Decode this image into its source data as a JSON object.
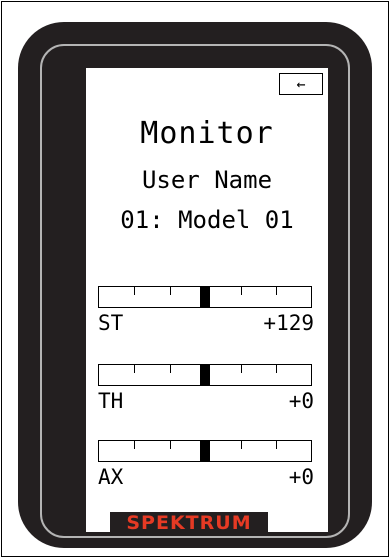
{
  "screen": {
    "back_button": "←",
    "title": "Monitor",
    "user_name": "User Name",
    "model": "01: Model 01"
  },
  "channels": [
    {
      "label": "ST",
      "value": "+129"
    },
    {
      "label": "TH",
      "value": "+0"
    },
    {
      "label": "AX",
      "value": "+0"
    }
  ],
  "brand": "SPEKTRUM",
  "colors": {
    "device_body": "#231f20",
    "bezel_ring": "#b4b4b4",
    "brand_text": "#e63a24",
    "screen_bg": "#ffffff"
  }
}
